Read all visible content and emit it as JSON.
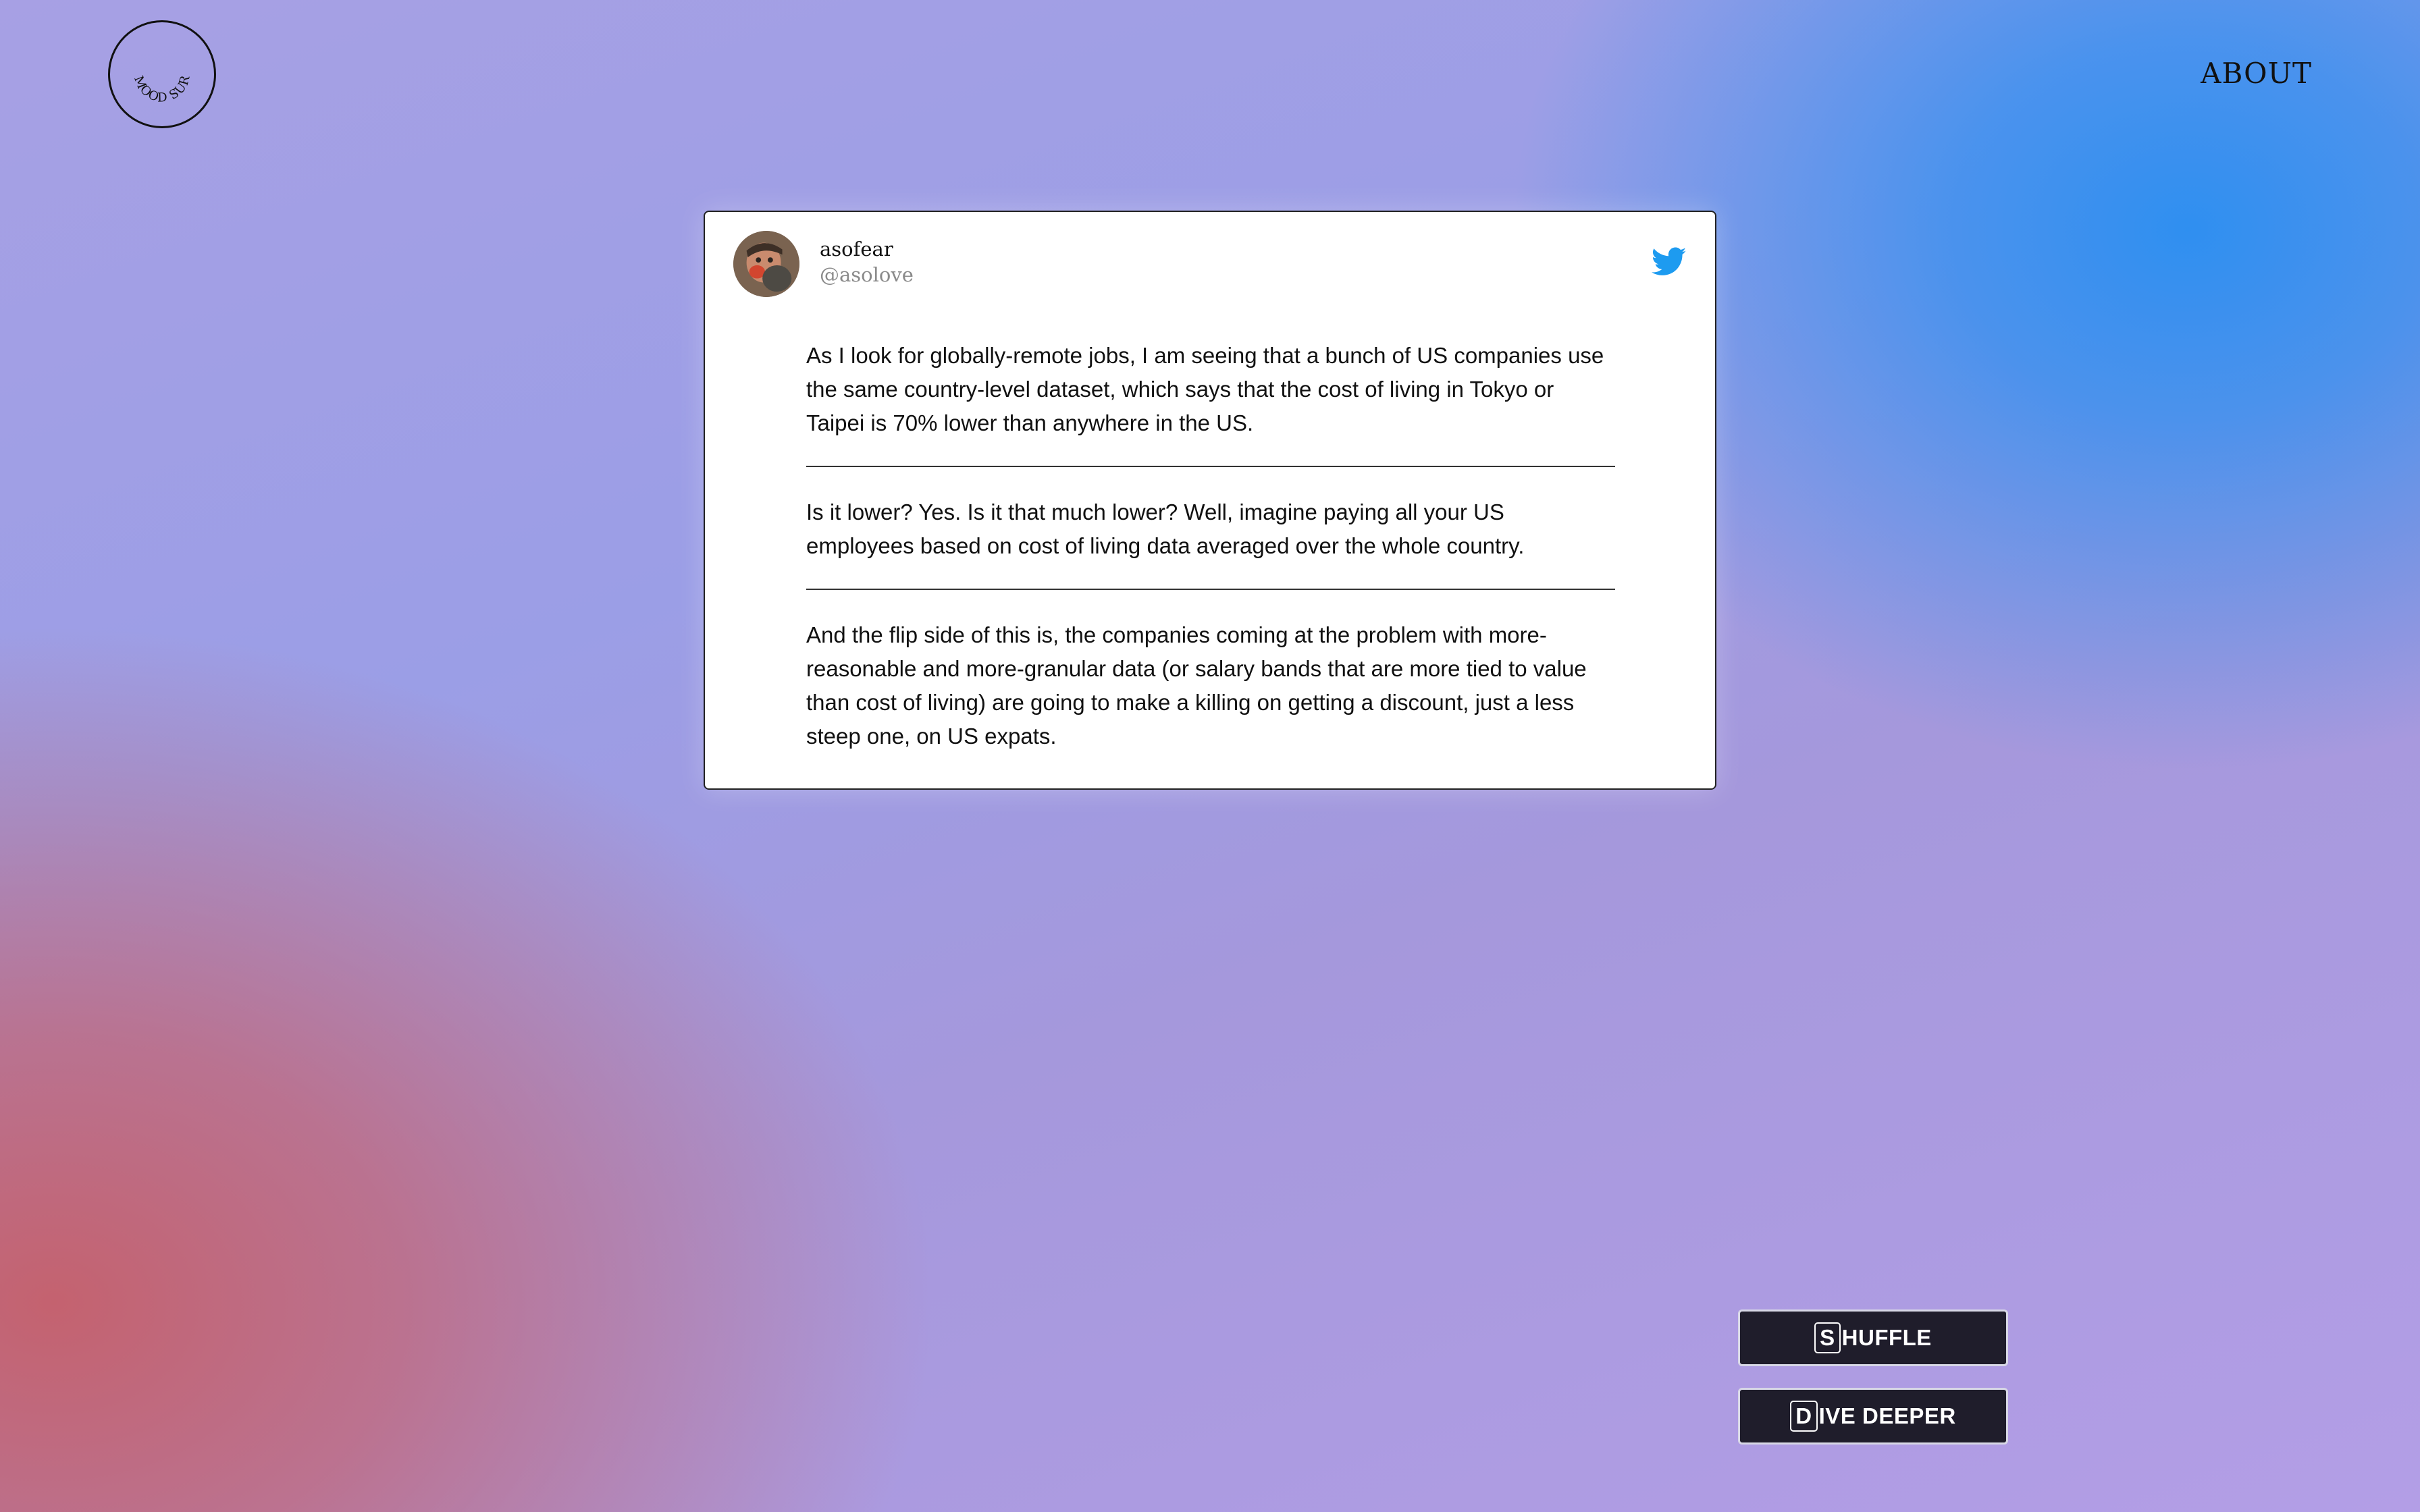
{
  "brand": {
    "logo_text": "MOOD SURF"
  },
  "nav": {
    "about_label": "ABOUT"
  },
  "tweet": {
    "author_name": "asofear",
    "author_handle": "@asolove",
    "icon": "twitter-bird-icon",
    "paragraphs": [
      "As I look for globally-remote jobs, I am seeing that a bunch of US companies use the same country-level dataset, which says that the cost of living in Tokyo or Taipei is 70% lower than anywhere in the US.",
      "Is it lower? Yes. Is it that much lower? Well, imagine paying all your US employees based on cost of living data averaged over the whole country.",
      "And the flip side of this is, the companies coming at the problem with more-reasonable and more-granular data (or salary bands that are more tied to value than cost of living) are going to make a killing on getting a discount, just a less steep one, on US expats."
    ]
  },
  "actions": {
    "shuffle": {
      "key": "S",
      "rest": "HUFFLE"
    },
    "dive_deeper": {
      "key": "D",
      "rest": "IVE DEEPER"
    }
  },
  "colors": {
    "twitter_blue": "#1d9bf0",
    "button_bg": "#1f1d2b"
  }
}
